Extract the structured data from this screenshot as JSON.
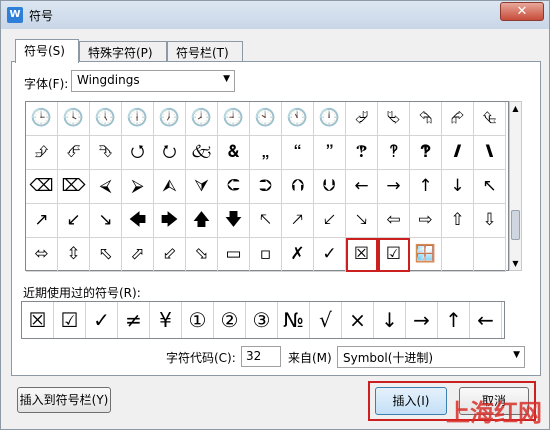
{
  "titlebar": {
    "title": "符号",
    "close_icon": "close-icon"
  },
  "tabs": [
    {
      "label": "符号(S)",
      "active": true
    },
    {
      "label": "特殊字符(P)",
      "active": false
    },
    {
      "label": "符号栏(T)",
      "active": false
    }
  ],
  "font": {
    "label": "字体(F):",
    "value": "Wingdings"
  },
  "grid": {
    "symbols": [
      "🕒",
      "🕓",
      "🕔",
      "🕕",
      "🕖",
      "🕗",
      "🕘",
      "🕙",
      "🕚",
      "🕛",
      "⮰",
      "⮱",
      "⮲",
      "⮳",
      "⮴",
      "⮵",
      "⮶",
      "⮷",
      "⭯",
      "⭮",
      "🙵",
      "🙴",
      "🙸",
      "🙶",
      "🙷",
      "🙹",
      "🙺",
      "🙻",
      "🙼",
      "🙽",
      "⌫",
      "⌦",
      "⮘",
      "⮚",
      "⮙",
      "⮛",
      "⮈",
      "⮊",
      "⮉",
      "⮋",
      "←",
      "→",
      "↑",
      "↓",
      "↖",
      "↗",
      "↙",
      "↘",
      "🡄",
      "🡆",
      "🡅",
      "🡇",
      "🡔",
      "🡕",
      "🡗",
      "🡖",
      "⇦",
      "⇨",
      "⇧",
      "⇩",
      "⬄",
      "⇳",
      "⬁",
      "⬀",
      "⬃",
      "⬂",
      "▭",
      "▫",
      "✗",
      "✓",
      "☒",
      "☑",
      "🪟",
      "",
      ""
    ],
    "highlighted": [
      70,
      71
    ]
  },
  "recent": {
    "label": "近期使用过的符号(R):",
    "symbols": [
      "☒",
      "☑",
      "✓",
      "≠",
      "¥",
      "①",
      "②",
      "③",
      "№",
      "√",
      "×",
      "↓",
      "→",
      "↑",
      "←"
    ]
  },
  "char_code": {
    "label": "字符代码(C):",
    "value": "32"
  },
  "from": {
    "label": "来自(M)",
    "value": "Symbol(十进制)"
  },
  "buttons": {
    "insert_to_bar": "插入到符号栏(Y)",
    "insert": "插入(I)",
    "cancel": "取消"
  },
  "watermark": "上海红网"
}
